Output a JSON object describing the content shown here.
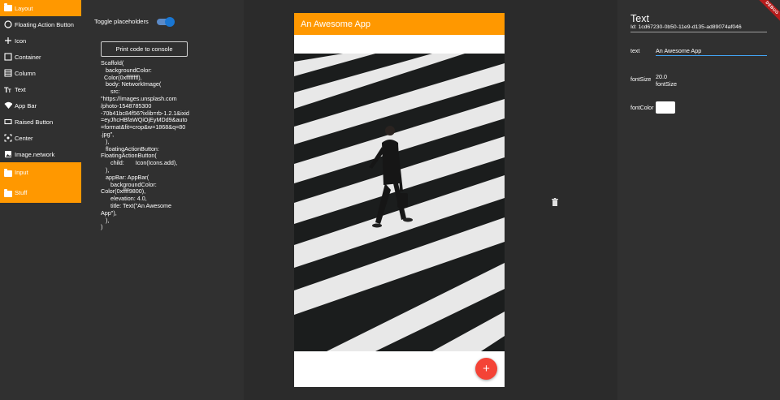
{
  "sidebar": {
    "items": [
      {
        "label": "Layout",
        "icon": "folder-icon",
        "active": true
      },
      {
        "label": "Floating Action Button",
        "icon": "circle-outline-icon"
      },
      {
        "label": "Icon",
        "icon": "plus-icon"
      },
      {
        "label": "Container",
        "icon": "square-outline-icon"
      },
      {
        "label": "Column",
        "icon": "column-icon"
      },
      {
        "label": "Text",
        "icon": "text-size-icon"
      },
      {
        "label": "App Bar",
        "icon": "wifi-icon"
      },
      {
        "label": "Raised Button",
        "icon": "button-icon"
      },
      {
        "label": "Center",
        "icon": "center-focus-icon"
      },
      {
        "label": "Image.network",
        "icon": "image-icon"
      }
    ],
    "groups": [
      {
        "label": "Input",
        "icon": "folder-icon"
      },
      {
        "label": "Stuff",
        "icon": "folder-icon"
      }
    ]
  },
  "codepanel": {
    "toggle_label": "Toggle placeholders",
    "toggle_on": true,
    "print_button": "Print code to console",
    "code": "Scaffold(\n   backgroundColor:\n  Color(0xffffffff),\n   body: NetworkImage(\n      src:\n\"https://images.unsplash.com\n/photo-1548785300\n-70b41bc84f56?ixlib=rb-1.2.1&ixid\n=eyJhcHBfaWQiOjEyMDd9&auto\n=format&fit=crop&w=1868&q=80\n.jpg\",\n   ),\n   floatingActionButton:\nFloatingActionButton(\n      child:       Icon(Icons.add),\n   ),\n   appBar: AppBar(\n      backgroundColor:\nColor(0xffff9800),\n      elevation: 4.0,\n      title: Text(\"An Awesome\nApp\"),\n   ),\n)"
  },
  "preview": {
    "appbar_title": "An Awesome App",
    "fab_icon": "add-icon",
    "fab_label": "+",
    "appbar_color": "#ff9800",
    "fab_color": "#f44336"
  },
  "props": {
    "title": "Text",
    "id_line": "Id: 1cd67230-0b50-11e9-d135-ad89074af046",
    "fields": {
      "text_label": "text",
      "text_value": "An Awesome App",
      "fontsize_label": "fontSize",
      "fontsize_value": "20.0",
      "fontsize_hint": "fontSize",
      "fontcolor_label": "fontColor",
      "fontcolor_value": "#ffffff"
    },
    "debug_banner": "DEBUG"
  }
}
